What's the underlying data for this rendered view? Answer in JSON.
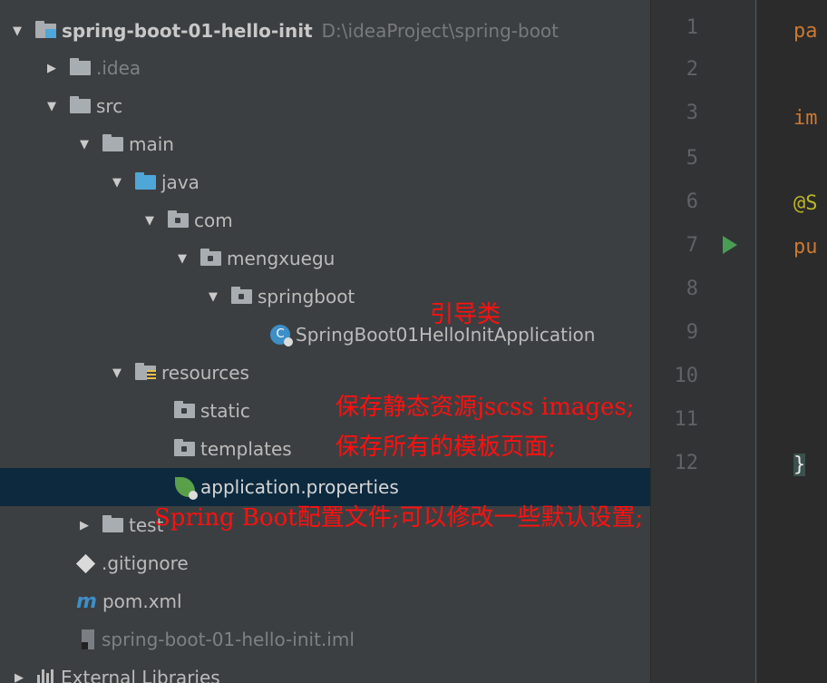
{
  "project": {
    "name": "spring-boot-01-hello-init",
    "path": "D:\\ideaProject\\spring-boot"
  },
  "tree": {
    "idea": ".idea",
    "src": "src",
    "main": "main",
    "java": "java",
    "com": "com",
    "mengxuegu": "mengxuegu",
    "springboot": "springboot",
    "app_class": "SpringBoot01HelloInitApplication",
    "resources": "resources",
    "static": "static",
    "templates": "templates",
    "properties": "application.properties",
    "test": "test",
    "gitignore": ".gitignore",
    "pom": "pom.xml",
    "iml": "spring-boot-01-hello-init.iml",
    "external": "External Libraries"
  },
  "icons": {
    "expanded_arrow": "chevron-down-icon",
    "collapsed_arrow": "chevron-right-icon",
    "m_glyph": "m"
  },
  "editor": {
    "line_numbers": [
      "1",
      "2",
      "3",
      "5",
      "6",
      "7",
      "8",
      "9",
      "10",
      "11",
      "12"
    ],
    "lines": {
      "l1": "pa",
      "l3": "im",
      "l6": "@S",
      "l7": "pu",
      "l12": "}"
    },
    "fold_plus": "+",
    "fold_minus": "−"
  },
  "annotations": {
    "guide_class": "引导类",
    "static_note": "保存静态资源jscss images;",
    "templates_note": "保存所有的模板页面;",
    "properties_note": "Spring Boot配置文件;可以修改一些默认设置;"
  },
  "colors": {
    "panel_bg": "#3c3f41",
    "selected_row": "#0d293e",
    "editor_bg": "#2b2b2b",
    "annotation_red": "#ff1010"
  }
}
